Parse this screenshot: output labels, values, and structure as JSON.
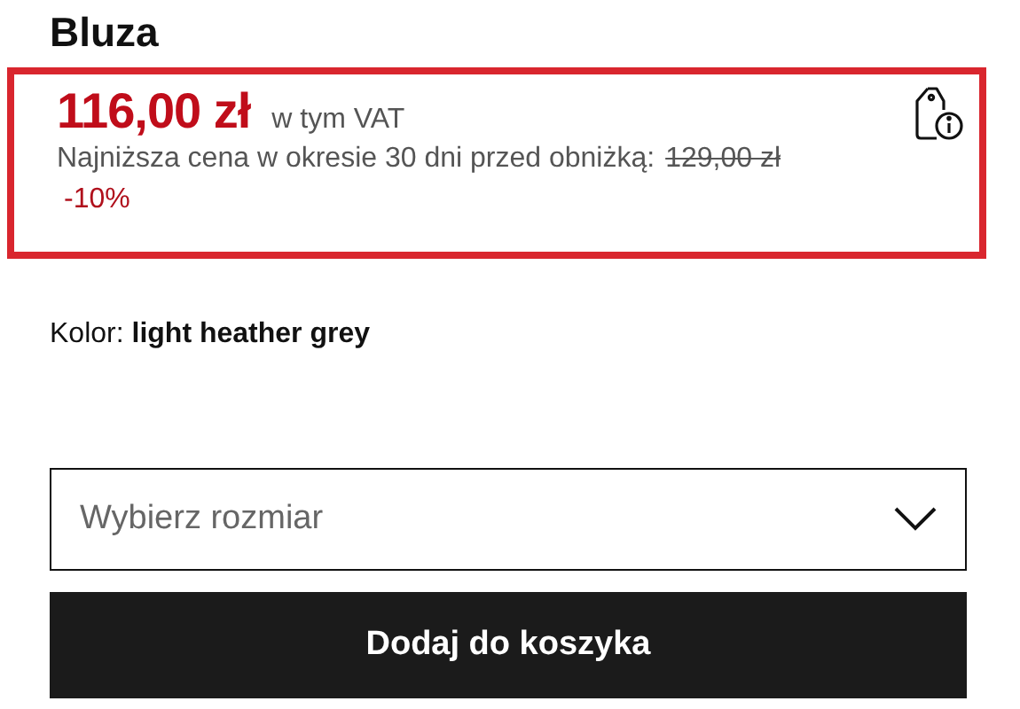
{
  "product": {
    "title": "Bluza"
  },
  "price": {
    "current": "116,00 zł",
    "vat_note": "w tym VAT",
    "lowest_label": "Najniższa cena w okresie 30 dni przed obniżką:",
    "old_price": "129,00 zł",
    "discount": "-10%"
  },
  "color_line": "Kolor: **light heather grey**",
  "size_select": {
    "placeholder": "Wybierz rozmiar"
  },
  "cart_button": "Dodaj do koszyka"
}
